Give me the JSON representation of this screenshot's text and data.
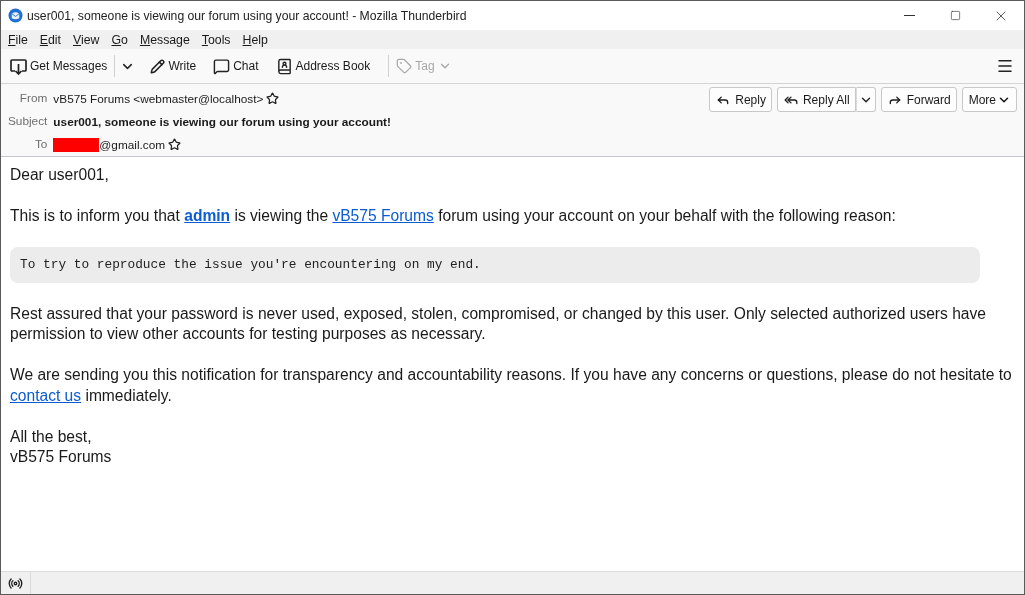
{
  "window": {
    "title": "user001, someone is viewing our forum using your account! - Mozilla Thunderbird"
  },
  "menu_bar": [
    "File",
    "Edit",
    "View",
    "Go",
    "Message",
    "Tools",
    "Help"
  ],
  "toolbar": {
    "buttons": [
      {
        "label": "Get Messages",
        "kind": "split",
        "disabled": false
      },
      {
        "label": "Write",
        "kind": "plain",
        "disabled": false
      },
      {
        "label": "Chat",
        "kind": "plain",
        "disabled": false
      },
      {
        "label": "Address Book",
        "kind": "plain",
        "disabled": false
      },
      {
        "label": "Tag",
        "kind": "menu",
        "disabled": true
      }
    ]
  },
  "header": {
    "fields": [
      {
        "label": "From",
        "kind": "address",
        "value": "vB575 Forums <webmaster@localhost>"
      },
      {
        "label": "Subject",
        "kind": "subject",
        "value": "user001, someone is viewing our forum using your account!"
      },
      {
        "label": "To",
        "kind": "address",
        "value": "@gmail.com",
        "redacted": true
      }
    ],
    "buttons": [
      {
        "label": "Reply",
        "kind": "plain"
      },
      {
        "label": "Reply All",
        "kind": "split"
      },
      {
        "label": "Forward",
        "kind": "plain"
      },
      {
        "label": "More",
        "kind": "menu"
      }
    ]
  },
  "body": {
    "paragraphs": [
      {
        "kind": "text",
        "parts": [
          {
            "kind": "plain",
            "text": "Dear user001,"
          }
        ]
      },
      {
        "kind": "text",
        "parts": [
          {
            "kind": "plain",
            "text": "This is to inform you that "
          },
          {
            "kind": "link",
            "text": "admin",
            "bold": true
          },
          {
            "kind": "plain",
            "text": " is viewing the "
          },
          {
            "kind": "link",
            "text": "vB575 Forums",
            "bold": false
          },
          {
            "kind": "plain",
            "text": " forum using your account on your behalf with the following reason:"
          }
        ]
      },
      {
        "kind": "quote",
        "text": "To try to reproduce the issue you're encountering on my end."
      },
      {
        "kind": "text",
        "parts": [
          {
            "kind": "plain",
            "text": "Rest assured that your password is never used, exposed, stolen, compromised, or changed by this user. Only selected authorized users have permission to view other accounts for testing purposes as necessary."
          }
        ]
      },
      {
        "kind": "text",
        "parts": [
          {
            "kind": "plain",
            "text": "We are sending you this notification for transparency and accountability reasons. If you have any concerns or questions, please do not hesitate to "
          },
          {
            "kind": "link",
            "text": "contact us",
            "bold": false
          },
          {
            "kind": "plain",
            "text": " immediately."
          }
        ]
      }
    ],
    "signature": {
      "closing": "All the best,",
      "name": "vB575 Forums"
    }
  }
}
